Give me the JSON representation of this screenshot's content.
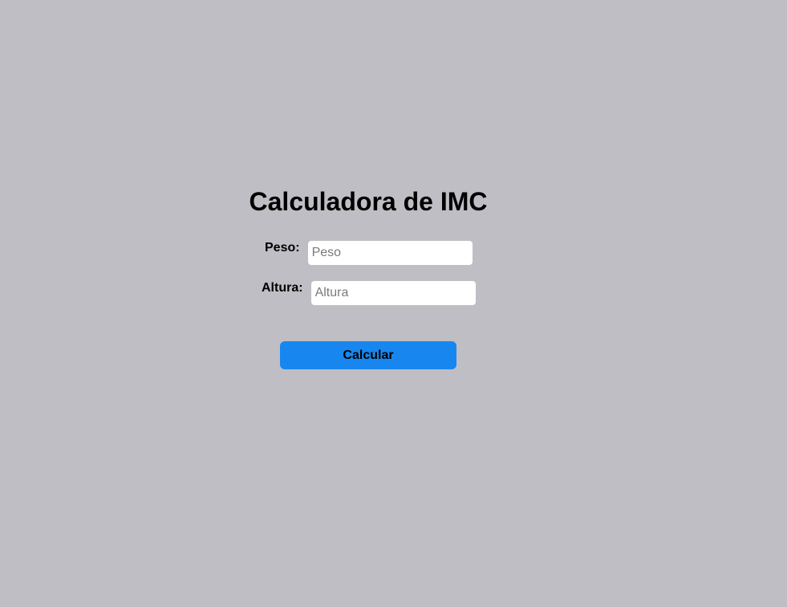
{
  "app": {
    "title": "Calculadora de IMC"
  },
  "form": {
    "peso": {
      "label": "Peso:",
      "placeholder": "Peso",
      "value": ""
    },
    "altura": {
      "label": "Altura:",
      "placeholder": "Altura",
      "value": ""
    },
    "submit_label": "Calcular"
  },
  "colors": {
    "background": "#bfbec4",
    "button": "#1787ef",
    "input_background": "#ffffff"
  }
}
